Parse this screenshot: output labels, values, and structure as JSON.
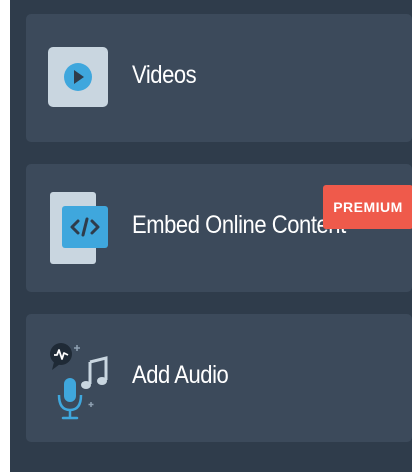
{
  "menu": {
    "items": [
      {
        "label": "Videos",
        "icon": "play-video-icon"
      },
      {
        "label": "Embed Online Content",
        "icon": "code-embed-icon",
        "badge": "PREMIUM"
      },
      {
        "label": "Add Audio",
        "icon": "audio-microphone-icon"
      }
    ]
  },
  "colors": {
    "panel_bg": "#2f3c4b",
    "card_bg": "#3c4a5b",
    "accent_blue": "#3fa7dd",
    "premium_badge": "#ef5a4b"
  }
}
